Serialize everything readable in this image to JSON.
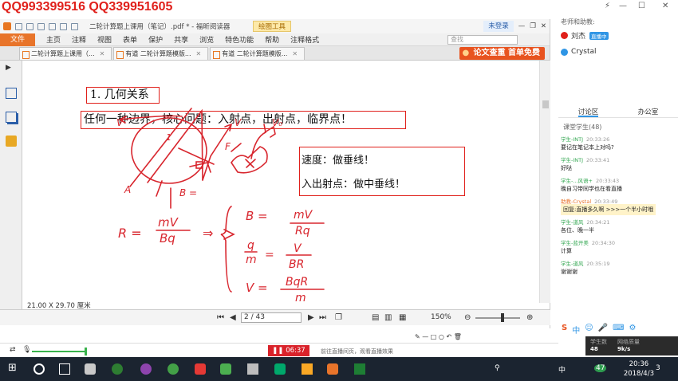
{
  "banner": {
    "text": "QQ993399516   QQ339951605"
  },
  "window_controls": {
    "min": "—",
    "max": "☐",
    "close": "✕",
    "signal": "⚡"
  },
  "pdf": {
    "title": "二轮计算题上课用（笔记）.pdf * - 福昕阅读器",
    "tool_tab": "绘图工具",
    "login_label": "未登录",
    "menu": {
      "file": "文件",
      "items": [
        "主页",
        "注释",
        "视图",
        "表单",
        "保护",
        "共享",
        "浏览",
        "特色功能",
        "帮助",
        "注释格式"
      ]
    },
    "search_placeholder": "查找",
    "tabs": [
      {
        "label": "二轮计算题上课用（..."
      },
      {
        "label": "有道 二轮计算题模版..."
      },
      {
        "label": "有道 二轮计算题模版..."
      }
    ],
    "promo": "论文查重  首单免费",
    "page_content": {
      "heading": "1. 几何关系",
      "core_question": "任何一种边界，核心问题：入射点，出射点，临界点！",
      "speed_line": "速度：做垂线！",
      "entry_line": "入出射点：做中垂线！"
    },
    "page_size": "21.00 X 29.70 厘米",
    "page_nav": {
      "current": "2 / 43"
    },
    "zoom": "150%"
  },
  "handwriting": {
    "v_left": "V",
    "v_right": "V",
    "v0": "V₀",
    "A": "A",
    "B": "B =",
    "F": "F",
    "one": "1",
    "arrow": "⇒",
    "R": "R =",
    "mv": "mV",
    "bq": "Bq",
    "B_num": "mV",
    "B_den": "Rq",
    "q": "q",
    "m": "m",
    "eq": "=",
    "q_num": "V",
    "q_den": "BR",
    "V": "V =",
    "V_num": "BqR",
    "V_den": "m"
  },
  "chat": {
    "header": "老师和助教:",
    "speakers": [
      {
        "name": "刘杰",
        "badge": "直播中"
      },
      {
        "name": "Crystal",
        "badge": ""
      }
    ],
    "tabs": [
      "讨论区",
      "办公室"
    ],
    "group_label": "课堂学生(48)",
    "messages": [
      {
        "user": "学生-INTJ",
        "time": "20:33:26",
        "text": "要记在笔记本上对吗?",
        "hl": false
      },
      {
        "user": "学生-INTJ",
        "time": "20:33:41",
        "text": "好哒",
        "hl": false
      },
      {
        "user": "学生-...风语+",
        "time": "20:33:43",
        "text": "晚自习带同学也在看直播",
        "hl": false
      },
      {
        "user": "助教-Crystal",
        "time": "20:33:49",
        "text": "回复:直播多久啊 >>>一个半小时哦",
        "hl": true
      },
      {
        "user": "学生-道风",
        "time": "20:34:21",
        "text": "各位、晚一半",
        "hl": false
      },
      {
        "user": "学生-蓝开美",
        "time": "20:34:30",
        "text": "计算",
        "hl": false
      },
      {
        "user": "学生-道风",
        "time": "20:35:19",
        "text": "谢谢谢",
        "hl": false
      }
    ],
    "stats": {
      "students_label": "学生数",
      "students": "48",
      "speed_label": "网络质量",
      "speed": "9k/s"
    }
  },
  "player": {
    "time": "06:37",
    "hint": "前往直播间页，观看直播效果"
  },
  "taskbar": {
    "time": "20:36",
    "date": "2018/4/3",
    "ime": "中",
    "notif": "3"
  }
}
